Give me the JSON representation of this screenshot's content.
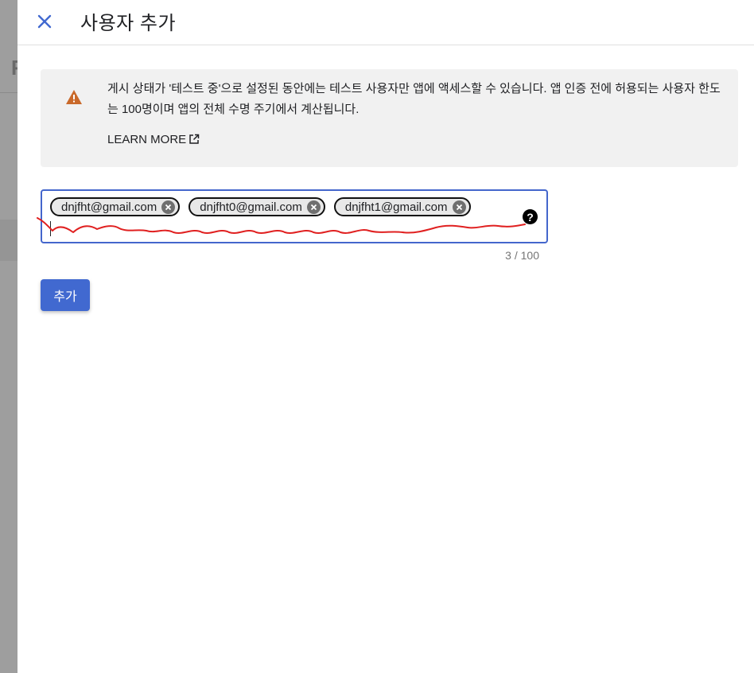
{
  "header": {
    "title": "사용자 추가",
    "close_icon": "close-icon"
  },
  "notice": {
    "icon": "warning-icon",
    "icon_color": "#c9692a",
    "text": "게시 상태가 '테스트 중'으로 설정된 동안에는 테스트 사용자만 앱에 액세스할 수 있습니다. 앱 인증 전에 허용되는 사용자 한도는 100명이며 앱의 전체 수명 주기에서 계산됩니다.",
    "learn_more_label": "LEARN MORE",
    "learn_more_icon": "external-link-icon"
  },
  "user_field": {
    "chips": [
      {
        "email": "dnjfht@gmail.com"
      },
      {
        "email": "dnjfht0@gmail.com"
      },
      {
        "email": "dnjfht1@gmail.com"
      }
    ],
    "help_icon": "help-icon",
    "counter": "3 / 100",
    "border_color": "#4466cc"
  },
  "actions": {
    "add_label": "추가",
    "add_color": "#4169d0"
  },
  "annotation": {
    "color": "#e02020"
  }
}
